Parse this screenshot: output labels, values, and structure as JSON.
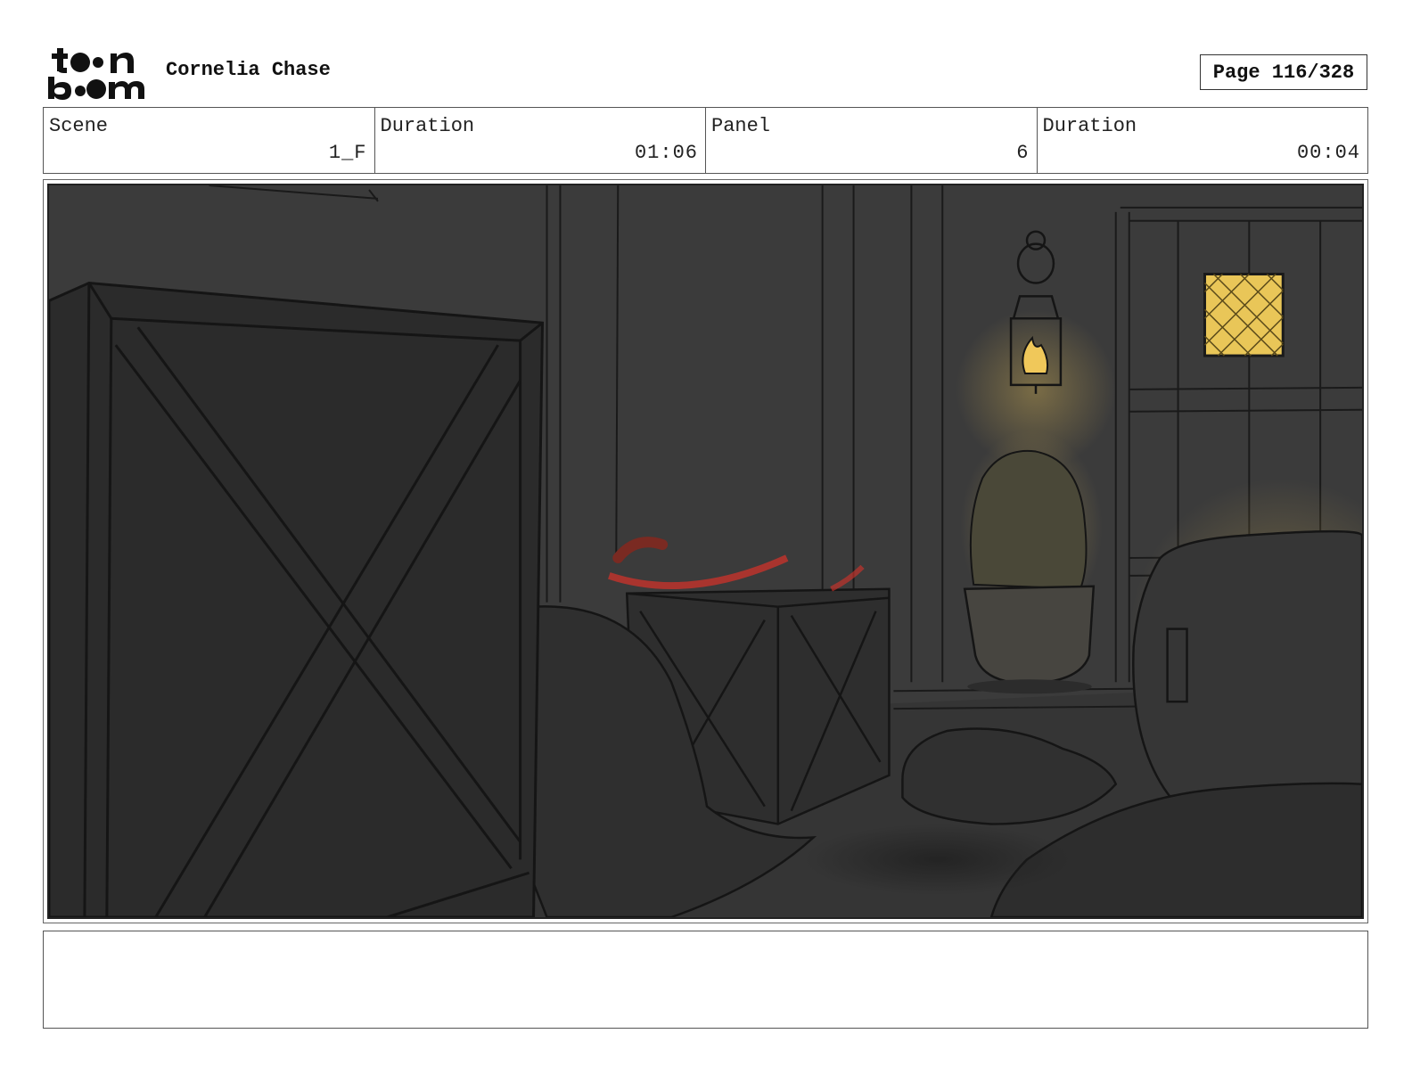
{
  "header": {
    "logo_text": "toonboom",
    "project_title": "Cornelia Chase",
    "page_label": "Page 116/328"
  },
  "info": {
    "scene_label": "Scene",
    "scene_value": "1_F",
    "scene_duration_label": "Duration",
    "scene_duration_value": "01:06",
    "panel_label": "Panel",
    "panel_value": "6",
    "panel_duration_label": "Duration",
    "panel_duration_value": "00:04"
  },
  "notes": {
    "text": ""
  },
  "colors": {
    "background_dark": "#3a3a3a",
    "lantern_glow": "#f0c85a",
    "red_streak": "#d8322a"
  },
  "icons": {
    "logo": "toon-boom-logo"
  }
}
